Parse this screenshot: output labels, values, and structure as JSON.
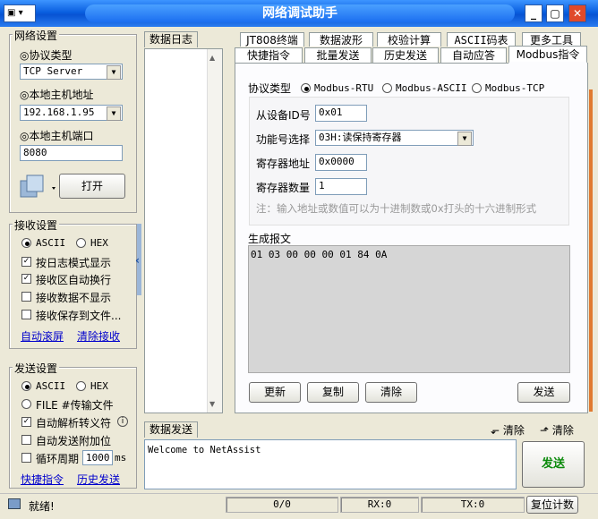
{
  "window": {
    "title": "网络调试助手"
  },
  "net": {
    "group_label": "网络设置",
    "protocol_label": "◎协议类型",
    "protocol_value": "TCP Server",
    "host_label": "◎本地主机地址",
    "host_value": "192.168.1.95",
    "port_label": "◎本地主机端口",
    "port_value": "8080",
    "open_button": "打开"
  },
  "recv": {
    "group_label": "接收设置",
    "ascii": "ASCII",
    "hex": "HEX",
    "opt_log_mode": "按日志模式显示",
    "opt_auto_wrap": "接收区自动换行",
    "opt_hide": "接收数据不显示",
    "opt_save_file": "接收保存到文件...",
    "auto_scroll": "自动滚屏",
    "clear_recv": "清除接收"
  },
  "send": {
    "group_label": "发送设置",
    "ascii": "ASCII",
    "hex": "HEX",
    "file": "FILE #传输文件",
    "opt_escape": "自动解析转义符",
    "opt_append": "自动发送附加位",
    "opt_cycle": "循环周期",
    "cycle_value": "1000",
    "cycle_unit": "ms",
    "quick_cmd": "快捷指令",
    "history": "历史发送"
  },
  "log": {
    "label": "数据日志"
  },
  "tabs_top": [
    "JT808终端",
    "数据波形",
    "校验计算",
    "ASCII码表",
    "更多工具"
  ],
  "tabs_bottom": [
    "快捷指令",
    "批量发送",
    "历史发送",
    "自动应答",
    "Modbus指令"
  ],
  "modbus": {
    "protocol_label": "协议类型",
    "proto_rtu": "Modbus-RTU",
    "proto_ascii": "Modbus-ASCII",
    "proto_tcp": "Modbus-TCP",
    "slave_label": "从设备ID号",
    "slave_value": "0x01",
    "func_label": "功能号选择",
    "func_value": "03H:读保持寄存器",
    "addr_label": "寄存器地址",
    "addr_value": "0x0000",
    "count_label": "寄存器数量",
    "count_value": "1",
    "note": "注：输入地址或数值可以为十进制数或0x打头的十六进制形式",
    "report_label": "生成报文",
    "report_value": "01 03 00 00 00 01 84 0A",
    "btn_update": "更新",
    "btn_copy": "复制",
    "btn_clear": "清除",
    "btn_send": "发送"
  },
  "sendarea": {
    "label": "数据发送",
    "clear1": "清除",
    "clear2": "清除",
    "text": "Welcome to NetAssist",
    "send_button": "发送"
  },
  "statusbar": {
    "state": "就绪!",
    "count": "0/0",
    "rx": "RX:0",
    "tx": "TX:0",
    "reset": "复位计数"
  }
}
